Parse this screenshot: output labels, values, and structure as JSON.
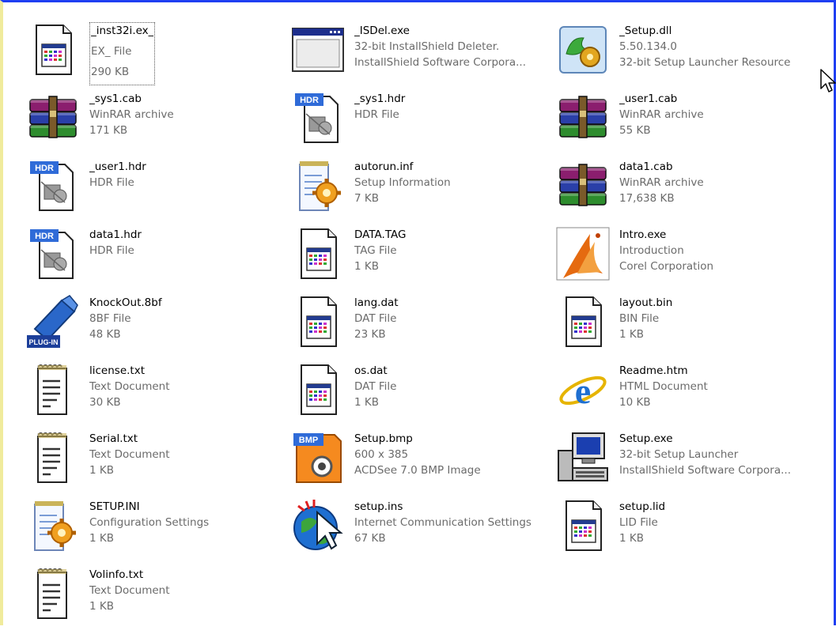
{
  "files": [
    {
      "name": "_inst32i.ex_",
      "line2": "EX_ File",
      "line3": "290 KB",
      "icon": "generic-document-icon",
      "selected": true
    },
    {
      "name": "_ISDel.exe",
      "line2": "32-bit InstallShield Deleter.",
      "line3": "InstallShield Software Corpora...",
      "icon": "application-window-icon"
    },
    {
      "name": "_Setup.dll",
      "line2": "5.50.134.0",
      "line3": "32-bit Setup Launcher Resource",
      "icon": "dll-gear-icon"
    },
    {
      "name": "_sys1.cab",
      "line2": "WinRAR archive",
      "line3": "171 KB",
      "icon": "winrar-archive-icon"
    },
    {
      "name": "_sys1.hdr",
      "line2": "HDR File",
      "line3": "",
      "icon": "hdr-file-icon"
    },
    {
      "name": "_user1.cab",
      "line2": "WinRAR archive",
      "line3": "55 KB",
      "icon": "winrar-archive-icon"
    },
    {
      "name": "_user1.hdr",
      "line2": "HDR File",
      "line3": "",
      "icon": "hdr-file-icon"
    },
    {
      "name": "autorun.inf",
      "line2": "Setup Information",
      "line3": "7 KB",
      "icon": "setup-information-icon"
    },
    {
      "name": "data1.cab",
      "line2": "WinRAR archive",
      "line3": "17,638 KB",
      "icon": "winrar-archive-icon"
    },
    {
      "name": "data1.hdr",
      "line2": "HDR File",
      "line3": "",
      "icon": "hdr-file-icon"
    },
    {
      "name": "DATA.TAG",
      "line2": "TAG File",
      "line3": "1 KB",
      "icon": "generic-document-icon"
    },
    {
      "name": "Intro.exe",
      "line2": "Introduction",
      "line3": "Corel Corporation",
      "icon": "corel-intro-icon"
    },
    {
      "name": "KnockOut.8bf",
      "line2": "8BF File",
      "line3": "48 KB",
      "icon": "plugin-icon"
    },
    {
      "name": "lang.dat",
      "line2": "DAT File",
      "line3": "23 KB",
      "icon": "generic-document-icon"
    },
    {
      "name": "layout.bin",
      "line2": "BIN File",
      "line3": "1 KB",
      "icon": "generic-document-icon"
    },
    {
      "name": "license.txt",
      "line2": "Text Document",
      "line3": "30 KB",
      "icon": "text-document-icon"
    },
    {
      "name": "os.dat",
      "line2": "DAT File",
      "line3": "1 KB",
      "icon": "generic-document-icon"
    },
    {
      "name": "Readme.htm",
      "line2": "HTML Document",
      "line3": "10 KB",
      "icon": "internet-explorer-icon"
    },
    {
      "name": "Serial.txt",
      "line2": "Text Document",
      "line3": "1 KB",
      "icon": "text-document-icon"
    },
    {
      "name": "Setup.bmp",
      "line2": "600 x 385",
      "line3": "ACDSee 7.0 BMP Image",
      "icon": "bmp-image-icon"
    },
    {
      "name": "Setup.exe",
      "line2": "32-bit Setup Launcher",
      "line3": "InstallShield Software Corpora...",
      "icon": "setup-computer-icon"
    },
    {
      "name": "SETUP.INI",
      "line2": "Configuration Settings",
      "line3": "1 KB",
      "icon": "setup-information-icon"
    },
    {
      "name": "setup.ins",
      "line2": "Internet Communication Settings",
      "line3": "67 KB",
      "icon": "internet-settings-icon"
    },
    {
      "name": "setup.lid",
      "line2": "LID File",
      "line3": "1 KB",
      "icon": "generic-document-icon"
    },
    {
      "name": "Volinfo.txt",
      "line2": "Text Document",
      "line3": "1 KB",
      "icon": "text-document-icon"
    }
  ],
  "icon_labels": {
    "hdr": "HDR",
    "bmp": "BMP",
    "plugin": "PLUG-IN"
  },
  "colors": {
    "window_border": "#1f3ff2",
    "left_edge": "#f0eb9c",
    "secondary_text": "#6b6b6b"
  }
}
